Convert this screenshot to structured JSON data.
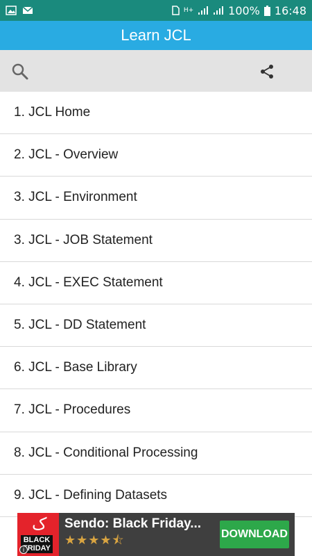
{
  "status_bar": {
    "battery": "100%",
    "time": "16:48",
    "network": "H+"
  },
  "app_bar": {
    "title": "Learn JCL"
  },
  "toolbar": {
    "search_icon": "search-icon",
    "share_icon": "share-icon"
  },
  "list": [
    "1. JCL Home",
    "2. JCL - Overview",
    "3. JCL - Environment",
    "3. JCL - JOB Statement",
    "4. JCL - EXEC Statement",
    "5. JCL - DD Statement",
    "6. JCL - Base Library",
    "7. JCL - Procedures",
    "8. JCL - Conditional Processing",
    "9. JCL - Defining Datasets"
  ],
  "ad": {
    "logo_glyph": "ک",
    "logo_line1": "BLACK",
    "logo_line2": "FRIDAY",
    "title": "Sendo: Black Friday...",
    "stars": "★★★★⯪",
    "rating": 4.5,
    "button_label": "DOWNLOAD",
    "info_icon": "info-icon"
  },
  "colors": {
    "status_bar": "#1a8a7d",
    "app_bar": "#29abe2",
    "toolbar": "#e3e3e3",
    "ad_button": "#2da84a"
  }
}
